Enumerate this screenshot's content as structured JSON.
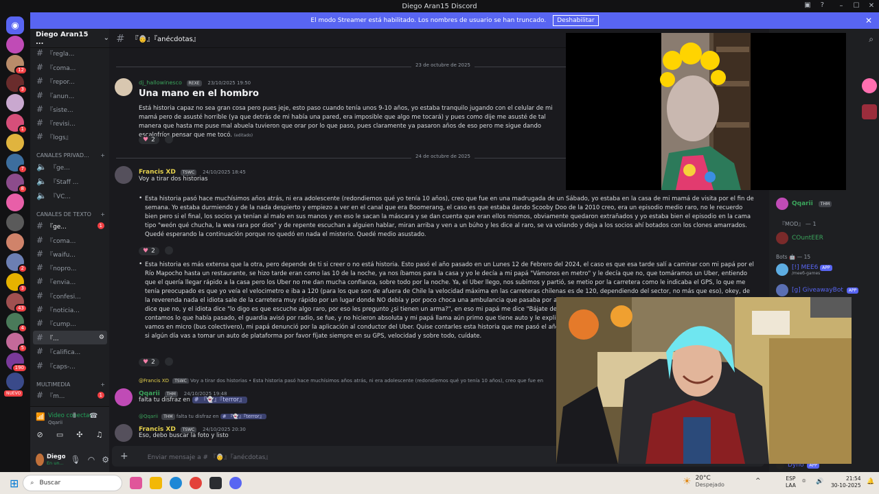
{
  "window": {
    "title": "Diego Aran15 Discord"
  },
  "banner": {
    "text": "El modo Streamer está habilitado. Los nombres de usuario se han truncado.",
    "button": "Deshabilitar"
  },
  "guild": {
    "name": "Diego Aran15 ..."
  },
  "channels": {
    "top": [
      "『regla...",
      "『coma...",
      "『repor...",
      "『anun...",
      "『siste...",
      "『revisi...",
      "『logs』"
    ],
    "cat_private": "CANALES PRIVAD...",
    "private": [
      "『ge...",
      "『Staff ...",
      "『VC..."
    ],
    "cat_text": "CANALES DE TEXTO",
    "text": [
      {
        "label": "『ge...",
        "badge": "1"
      },
      {
        "label": "『coma..."
      },
      {
        "label": "『waifu..."
      },
      {
        "label": "『nopro..."
      },
      {
        "label": "『envia..."
      },
      {
        "label": "『confesi..."
      },
      {
        "label": "『noticia..."
      },
      {
        "label": "『cump..."
      },
      {
        "label": "『..."
      },
      {
        "label": "『califica..."
      },
      {
        "label": "『caps-..."
      }
    ],
    "cat_media": "MULTIMEDIA",
    "media": [
      {
        "label": "『m...",
        "badge": "1"
      }
    ]
  },
  "voice": {
    "status": "Video conectac",
    "user": "Qqarii"
  },
  "userpanel": {
    "name": "Diego ...",
    "status": "En un..."
  },
  "header": {
    "channel": "『👵』『anécdotas』"
  },
  "messages": {
    "date1": "23 de octubre de 2025",
    "m1": {
      "author": "dj_hallowinesco",
      "tag": "REXE",
      "time": "23/10/2025 19:50",
      "title": "Una mano en el hombro",
      "body": "Está historia capaz no sea gran cosa pero pues jeje, esto paso cuando tenía unos 9-10 años, yo estaba tranquilo jugando con el celular de mi mamá pero de asusté horrible (ya que detrás de mi había una pared, era imposible que algo me tocará) y pues como dije me asusté de tal manera que hasta me puse mal abuela tuvieron que orar por lo que paso, pues claramente ya pasaron años de eso pero me sigue dando escalofríos pensar que me tocó.",
      "edited": "(editado)",
      "reactions": "2"
    },
    "date2": "24 de octubre de 2025",
    "m2": {
      "author": "Francis XD",
      "tag": "TSWC",
      "time": "24/10/2025 18:45",
      "intro": "Voy a tirar dos historias",
      "story1": "Esta historia pasó hace muchísimos años atrás, ni era adolescente (redondiemos qué yo tenía 10 años), creo que fue en una madrugada de un Sábado, yo estaba en la casa de mi mamá de visita por el fin de semana. Yo estaba durmiendo y de la nada despierto y empiezo a ver en el canal que era Boomerang, el caso es que estaba dando Scooby Doo de la 2010 creo, era un episodio medio raro, no le recuerdo bien pero si el final, los socios ya tenían al malo en sus manos y en eso le sacan la máscara y se dan cuenta que eran ellos mismos, obviamente quedaron extrañados y yo estaba bien el episodio en la cama tipo \"weón qué chucha, la wea rara por dios\" y de repente escuchan a alguien hablar, miran arriba y ven a un búho y les dice al raro, se va volando y deja a los socios ahí botados con los clones amarrados. Quedé esperando la continuación porque no quedó en nada el misterio. Quedé medio asustado.",
      "reactions1": "2",
      "story2": "Esta historia es más extensa que la otra, pero depende de ti si creer o no está historia. Esto pasó el año pasado en un Lunes 12 de Febrero del 2024, el caso es que esa tarde salí a caminar con mi papá por el Río Mapocho hasta un restaurante, se hizo tarde eran como las 10 de la noche, ya nos íbamos para la casa y yo le decía a mi papá \"Vámonos en metro\" y le decía que no, que tomáramos un Uber, entiendo que el quería llegar rápido a la casa pero los Uber no me dan mucha confianza, sobre todo por la noche. Ya, el Uber llego, nos subimos y partió, se metio por la carretera como le indicaba el GPS, lo que me tenía preocupado es que yo veía el velocimetro e iba a 120 (para los que son de afuera de Chile la velocidad máxima en las carreteras chilenas es de 120, dependiendo del sector, no más que eso), okey, de la reverenda nada el idiota sale de la carretera muy rápido por un lugar donde NO debía y por poco choca una ambulancia que pasaba por ahí. Detiene el auto nos mira y nos dice algo como \"¿uste papá le dice que no, y el idiota dice \"lo digo es que escuche algo raro, por eso les pregunto ¿si tienen un arma?\", en eso mi papá me dice \"Bájate del a noche, por \"suerte\" encontramos una patrulla municipal y le contamos lo que había pasado, el guardia avisó por radio, se fue, y no hicieron absoluta y mi papá llama aún primo que tiene auto y le explica lo que pasó y dice que no está en su casa. Le decía por favor vamos en micro (bus colectivero), mi papá denunció por la aplicación al conductor del Uber. Quise contarles esta historia que me pasó el año pasado para que tenga precaución con plataforma de transporte, si algún día vas a tomar un auto de plataforma por favor fíjate siempre en su GPS, velocidad y sobre todo, cuídate.",
      "reactions2": "2"
    },
    "m3": {
      "reply_author": "@Francis XD",
      "reply_tag": "TSWC",
      "reply_text": "Voy a tirar dos historias • Esta historia pasó hace muchísimos años atrás, ni era adolescente (redondiemos qué yo tenía 10 años), creo que fue en",
      "author": "Qqarii",
      "tag": "THM",
      "time": "24/10/2025 19:48",
      "body": "falta tu disfraz en",
      "mention": "# 『👻』『terror』"
    },
    "m4": {
      "reply_author": "@Qqarii",
      "reply_tag": "THM",
      "reply_text": "falta tu disfraz en",
      "reply_mention": "# 『👻』『terror』",
      "author": "Francis XD",
      "tag": "TSWC",
      "time": "24/10/2025 20:30",
      "body": "Eso, debo buscar la foto y listo"
    }
  },
  "input": {
    "placeholder": "Enviar mensaje a # 『👵』『anécdotas』"
  },
  "members": {
    "top_user": "Qqarii",
    "top_tag": "THM",
    "mod_header": "『MOD』 — 1",
    "mod_user": "COuntEER",
    "bots_header": "Bots 🤖 — 15",
    "bot1": "[!] MEE6",
    "bot1_sub": "/meeб-games",
    "bot2": "[g] GiveawayBot",
    "bot_last": "Dyno",
    "app": "APP"
  },
  "taskbar": {
    "search": "Buscar",
    "temp": "20°C",
    "weather": "Despejado",
    "lang1": "ESP",
    "lang2": "LAA",
    "time": "21:54",
    "date": "30-10-2025"
  },
  "colors": {
    "accent": "#5865f2",
    "danger": "#f23f43",
    "francis": "#e8d44d",
    "qqarii": "#3ba55c",
    "dj": "#3ba55c"
  }
}
